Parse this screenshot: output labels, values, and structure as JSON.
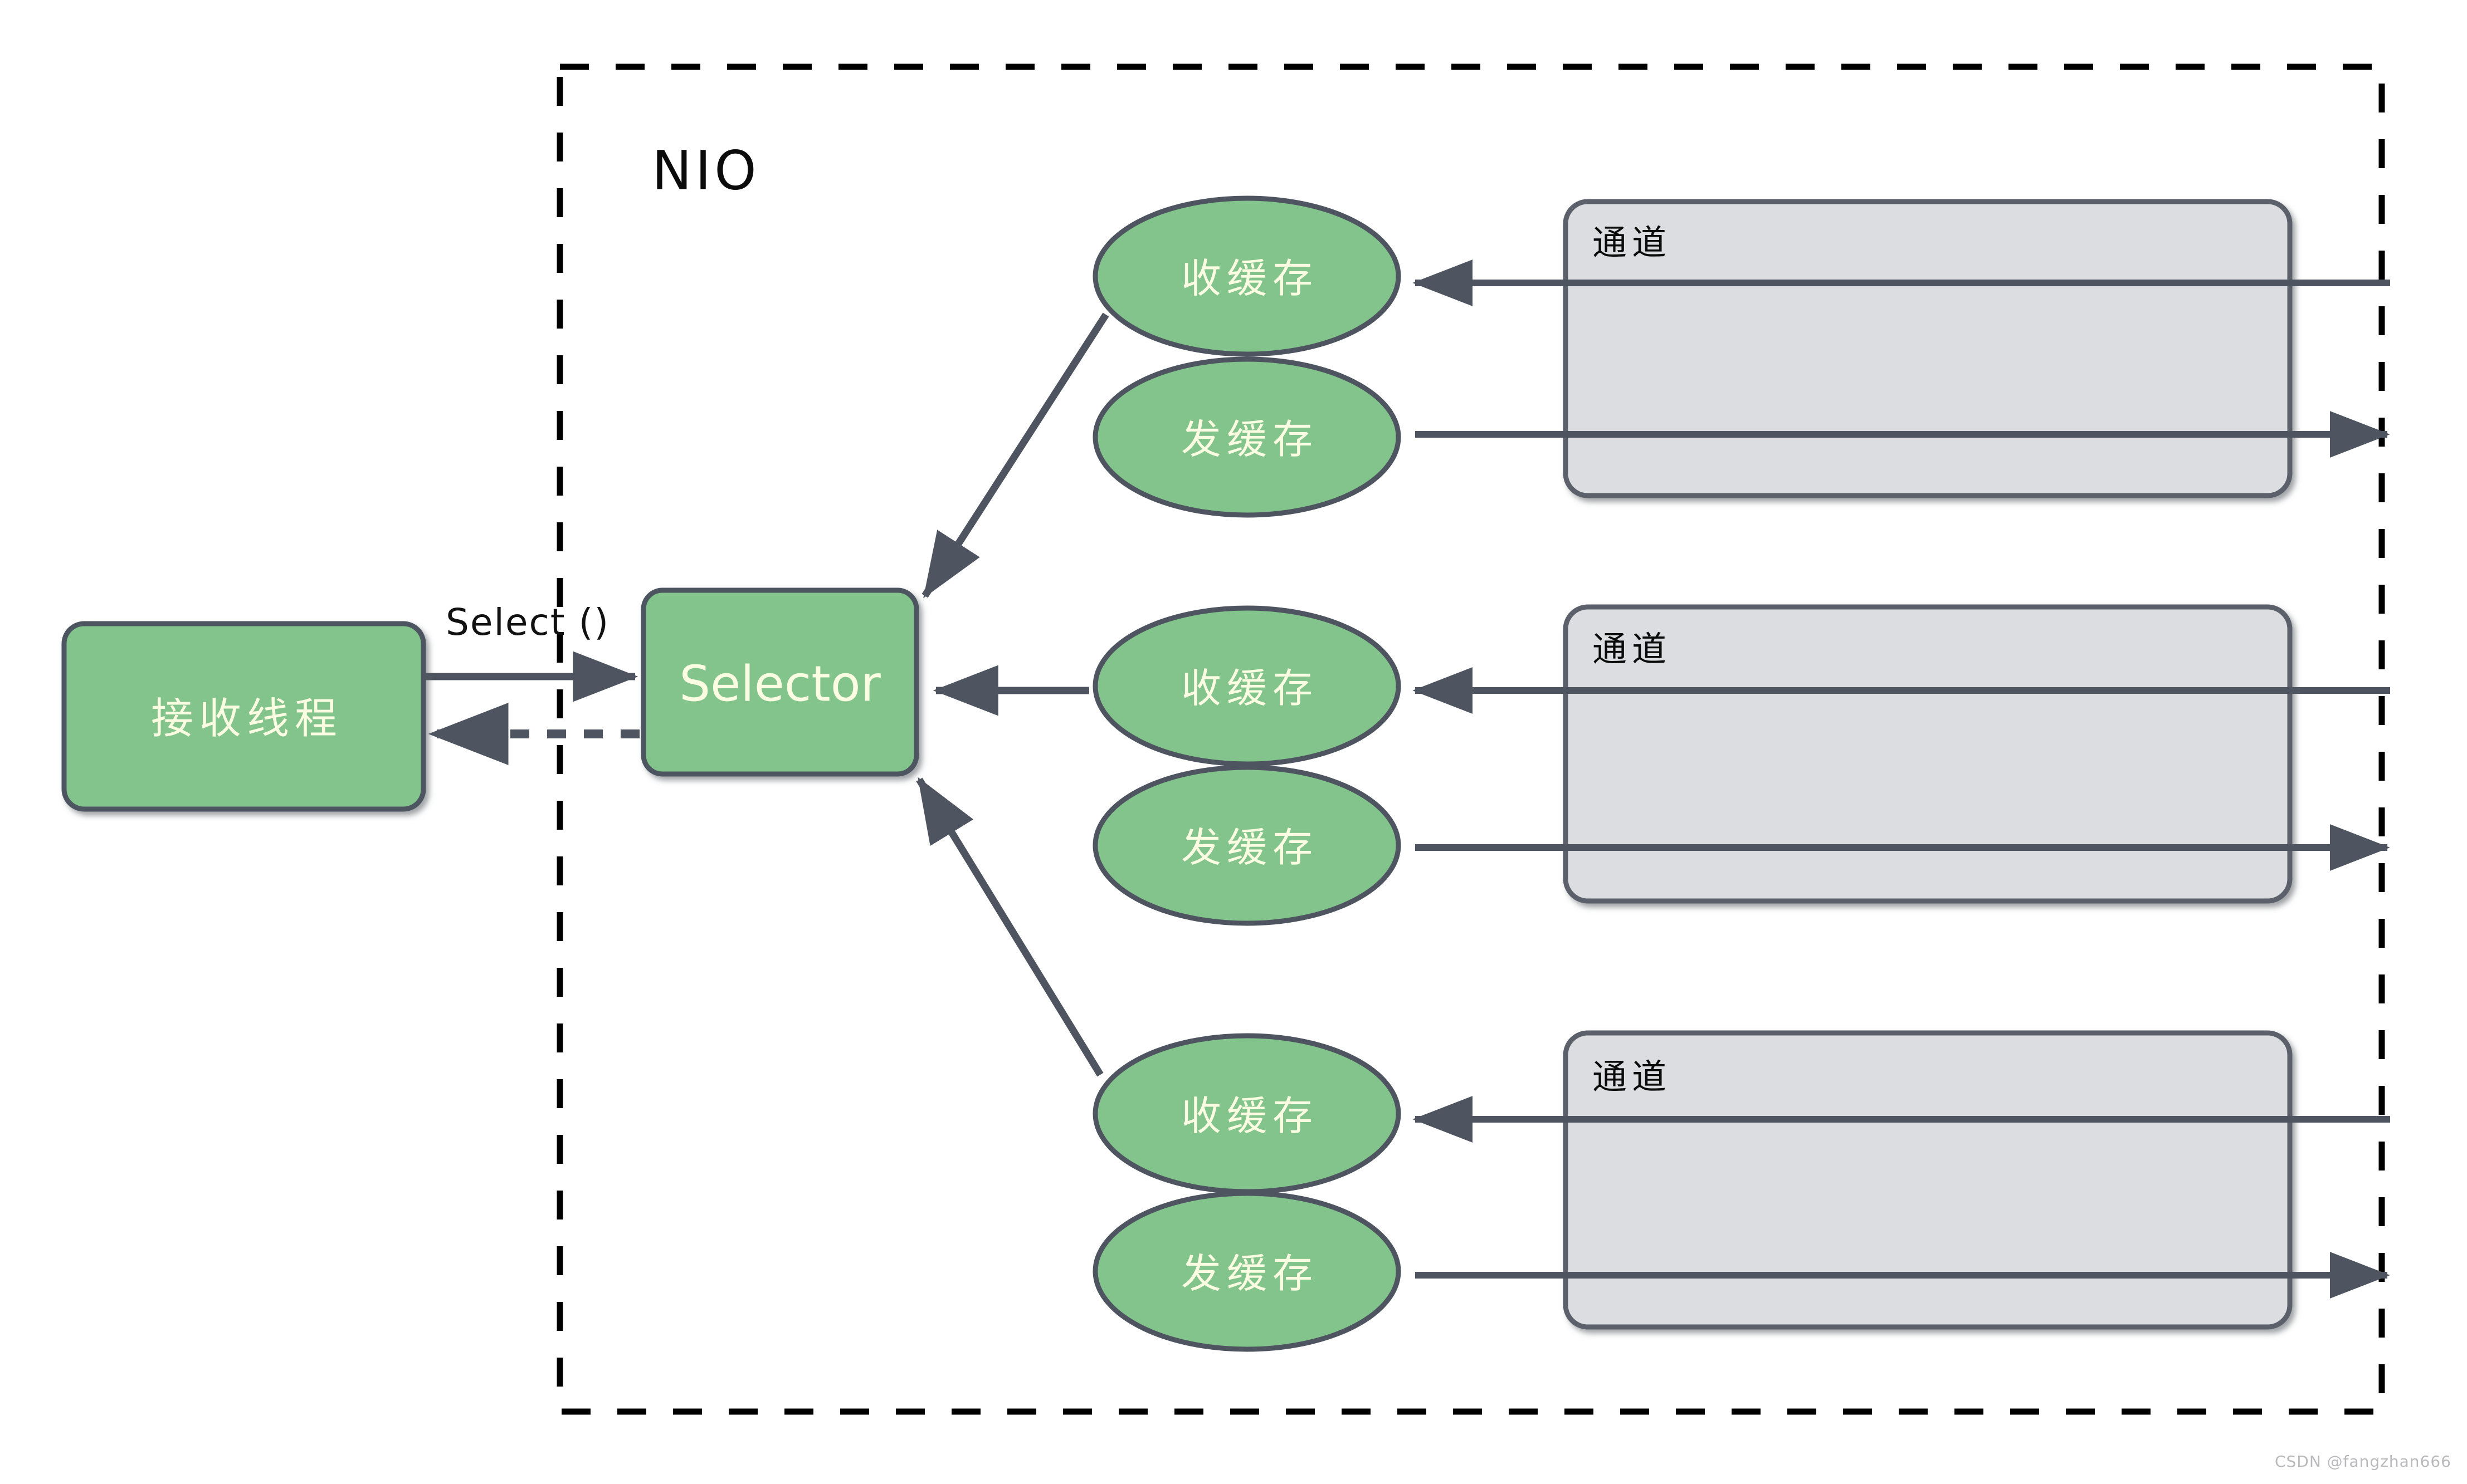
{
  "diagram": {
    "title": "NIO",
    "boundary": {
      "label": "NIO",
      "style": "dashed",
      "color": "#000000"
    },
    "palette": {
      "node_fill": "#82c48b",
      "node_stroke": "#4e5560",
      "node_text": "#fbfde2",
      "channel_fill": "#dcdde0",
      "channel_stroke": "#5b616b",
      "line": "#4e5560",
      "boundary": "#000000",
      "background": "#ffffff"
    },
    "nodes": {
      "thread": {
        "label": "接收线程",
        "shape": "rounded-rect"
      },
      "selector": {
        "label": "Selector",
        "shape": "rounded-rect"
      },
      "recv_buffer": {
        "label": "收缓存",
        "shape": "ellipse"
      },
      "send_buffer": {
        "label": "发缓存",
        "shape": "ellipse"
      },
      "channel": {
        "label": "通道",
        "shape": "rounded-rect"
      }
    },
    "edges": {
      "select_call": {
        "label": "Select ()",
        "style": "solid",
        "direction": "thread-to-selector"
      },
      "select_return": {
        "label": "",
        "style": "dotted",
        "direction": "selector-to-thread"
      }
    },
    "groups": [
      {
        "index": 1,
        "recv_label": "收缓存",
        "send_label": "发缓存",
        "channel_label": "通道"
      },
      {
        "index": 2,
        "recv_label": "收缓存",
        "send_label": "发缓存",
        "channel_label": "通道"
      },
      {
        "index": 3,
        "recv_label": "收缓存",
        "send_label": "发缓存",
        "channel_label": "通道"
      }
    ]
  },
  "watermark": {
    "text": "CSDN @fangzhan666"
  }
}
